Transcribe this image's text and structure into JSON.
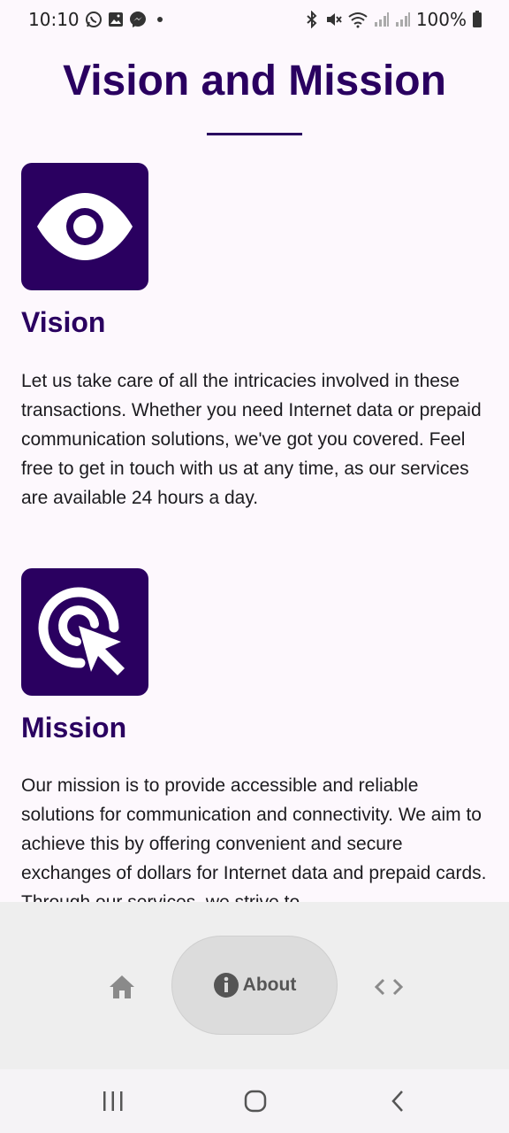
{
  "status_bar": {
    "time": "10:10",
    "battery": "100%",
    "notification_icons": [
      "whatsapp-icon",
      "gallery-icon",
      "messenger-icon",
      "dot"
    ],
    "system_icons": [
      "bluetooth-icon",
      "mute-icon",
      "wifi-icon",
      "signal-icon",
      "signal-icon",
      "battery-icon"
    ]
  },
  "page": {
    "title": "Vision and Mission"
  },
  "vision": {
    "icon": "eye-icon",
    "heading": "Vision",
    "body": "Let us take care of all the intricacies involved in these transactions. Whether you need Internet data or prepaid communication solutions, we've got you covered. Feel free to get in touch with us at any time, as our services are available 24 hours a day."
  },
  "mission": {
    "icon": "target-cursor-icon",
    "heading": "Mission",
    "body": "Our mission is to provide accessible and reliable solutions for communication and connectivity. We aim to achieve this by offering convenient and secure exchanges of dollars for Internet data and prepaid cards. Through our services, we strive to"
  },
  "bottom_nav": {
    "items": [
      {
        "icon": "home-icon",
        "label": ""
      },
      {
        "icon": "info-icon",
        "label": "About"
      },
      {
        "icon": "code-icon",
        "label": ""
      }
    ],
    "selected": "About"
  },
  "colors": {
    "brand": "#2a0060",
    "background": "#fdf8fd",
    "nav_background": "#eeeeee",
    "nav_selected": "#dcdcdc"
  }
}
